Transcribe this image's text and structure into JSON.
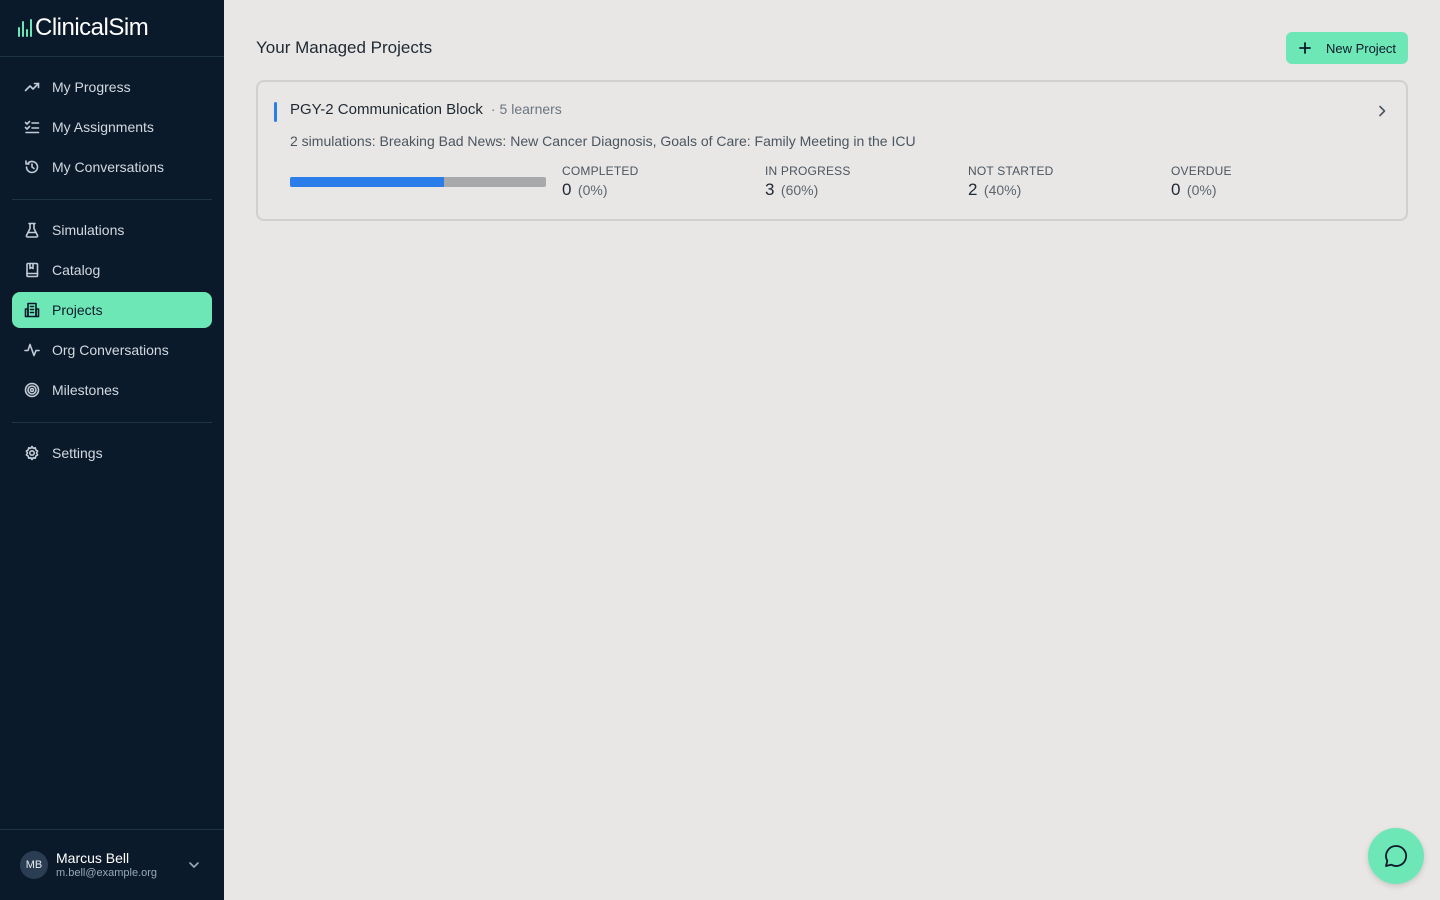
{
  "app": {
    "name": "ClinicalSim"
  },
  "sidebar": {
    "groups": [
      [
        {
          "label": "My Progress",
          "icon": "trending-up-icon"
        },
        {
          "label": "My Assignments",
          "icon": "checklist-icon"
        },
        {
          "label": "My Conversations",
          "icon": "history-icon"
        }
      ],
      [
        {
          "label": "Simulations",
          "icon": "flask-icon"
        },
        {
          "label": "Catalog",
          "icon": "book-icon"
        },
        {
          "label": "Projects",
          "icon": "building-icon",
          "active": true
        },
        {
          "label": "Org Conversations",
          "icon": "activity-icon"
        },
        {
          "label": "Milestones",
          "icon": "target-icon"
        }
      ],
      [
        {
          "label": "Settings",
          "icon": "gear-icon"
        }
      ]
    ]
  },
  "user": {
    "initials": "MB",
    "name": "Marcus Bell",
    "email": "m.bell@example.org"
  },
  "main": {
    "title": "Your Managed Projects",
    "new_project_label": "New Project"
  },
  "project": {
    "title": "PGY-2 Communication Block",
    "separator": "·",
    "learners": "5 learners",
    "description": "2 simulations: Breaking Bad News: New Cancer Diagnosis, Goals of Care: Family Meeting in the ICU",
    "progress_fraction": 0.6,
    "stats": [
      {
        "label": "COMPLETED",
        "value": "0",
        "percent": "(0%)"
      },
      {
        "label": "IN PROGRESS",
        "value": "3",
        "percent": "(60%)"
      },
      {
        "label": "NOT STARTED",
        "value": "2",
        "percent": "(40%)"
      },
      {
        "label": "OVERDUE",
        "value": "0",
        "percent": "(0%)"
      }
    ]
  },
  "colors": {
    "accent": "#6ee7b7",
    "sidebar_bg": "#0b1a2a",
    "progress_blue": "#2b7de9",
    "page_bg": "#e8e7e5"
  }
}
